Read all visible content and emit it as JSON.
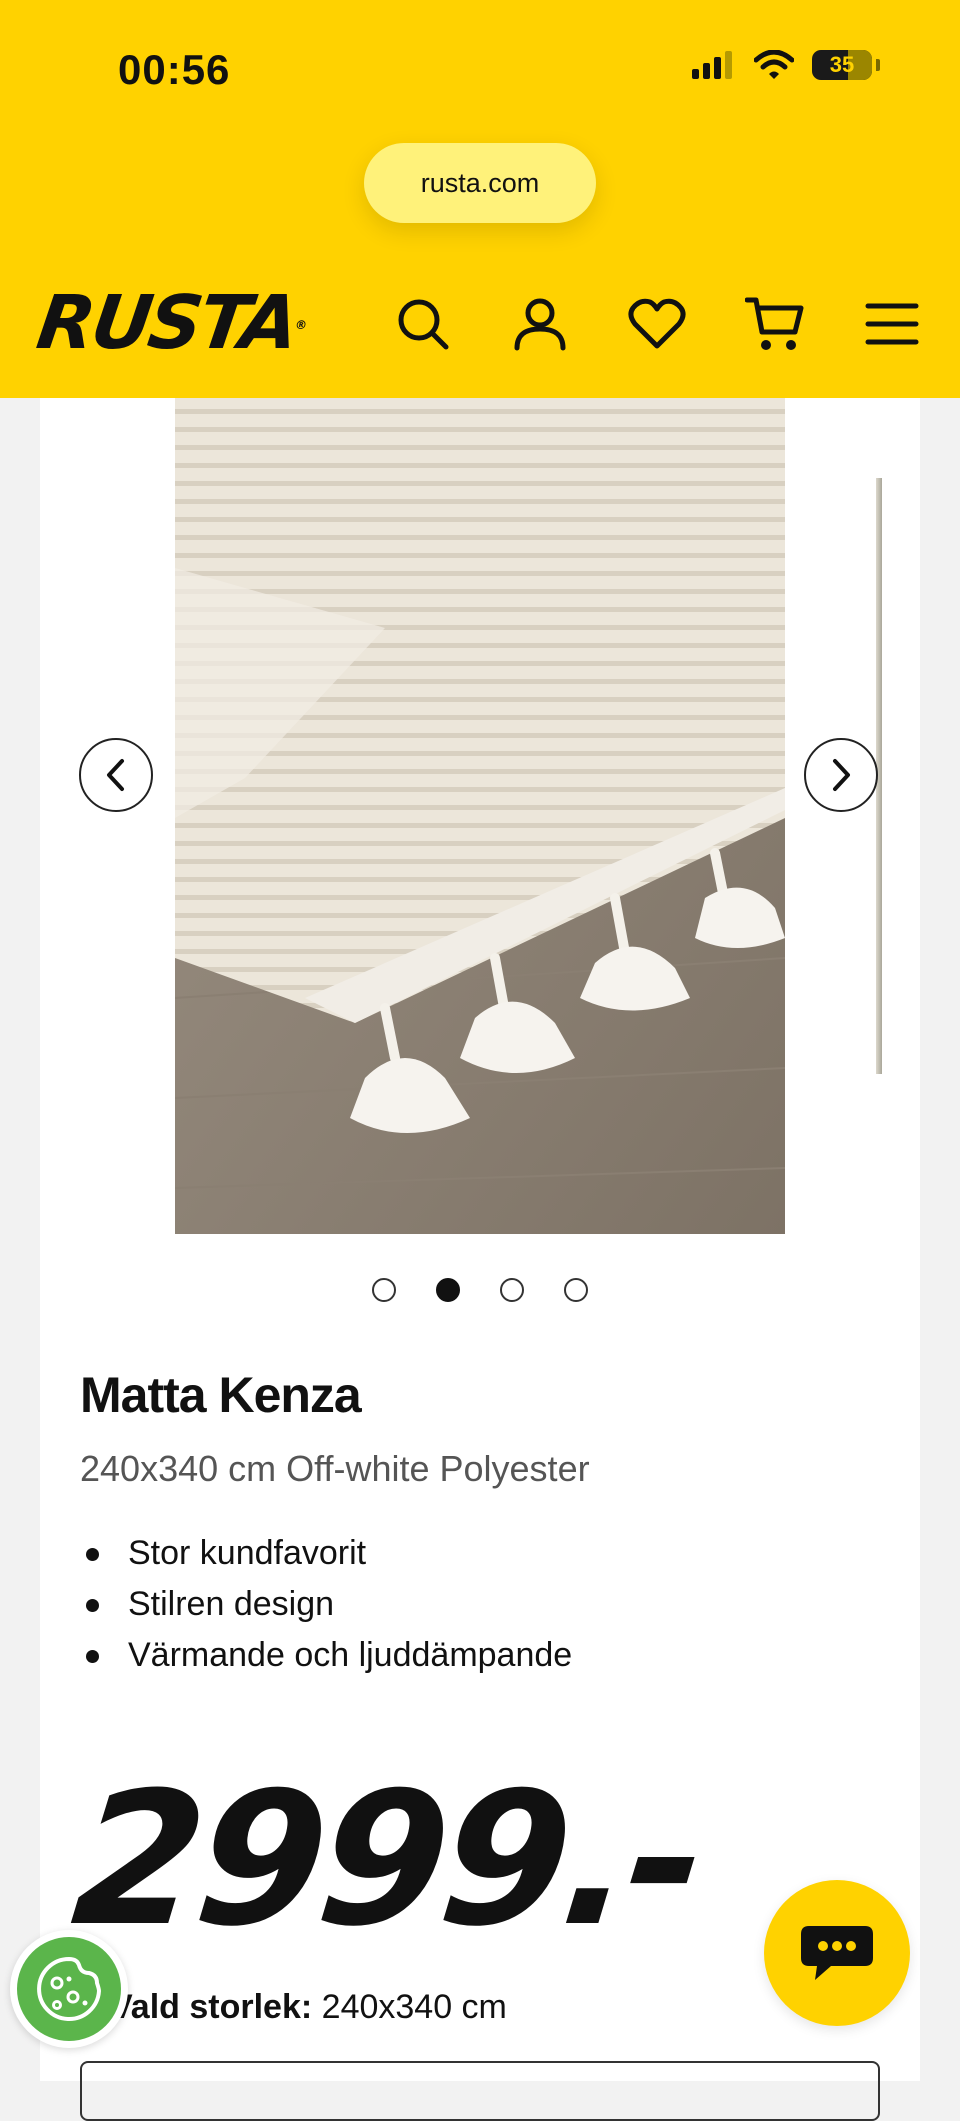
{
  "status_bar": {
    "time": "00:56",
    "battery": "35"
  },
  "browser": {
    "url": "rusta.com"
  },
  "header": {
    "logo": "RUSTA",
    "logo_mark": "®",
    "icons": [
      "search-icon",
      "account-icon",
      "wishlist-heart-icon",
      "cart-icon",
      "menu-icon"
    ]
  },
  "carousel": {
    "slide_count": 4,
    "active_index": 1
  },
  "product": {
    "title": "Matta Kenza",
    "subtitle": "240x340 cm Off-white Polyester",
    "features": [
      "Stor kundfavorit",
      "Stilren design",
      "Värmande och ljuddämpande"
    ],
    "price": "2999.-"
  },
  "size": {
    "label": "Vald storlek:",
    "value": "240x340 cm"
  },
  "colors": {
    "brand_yellow": "#ffd200",
    "cookie_green": "#5bb54b"
  }
}
